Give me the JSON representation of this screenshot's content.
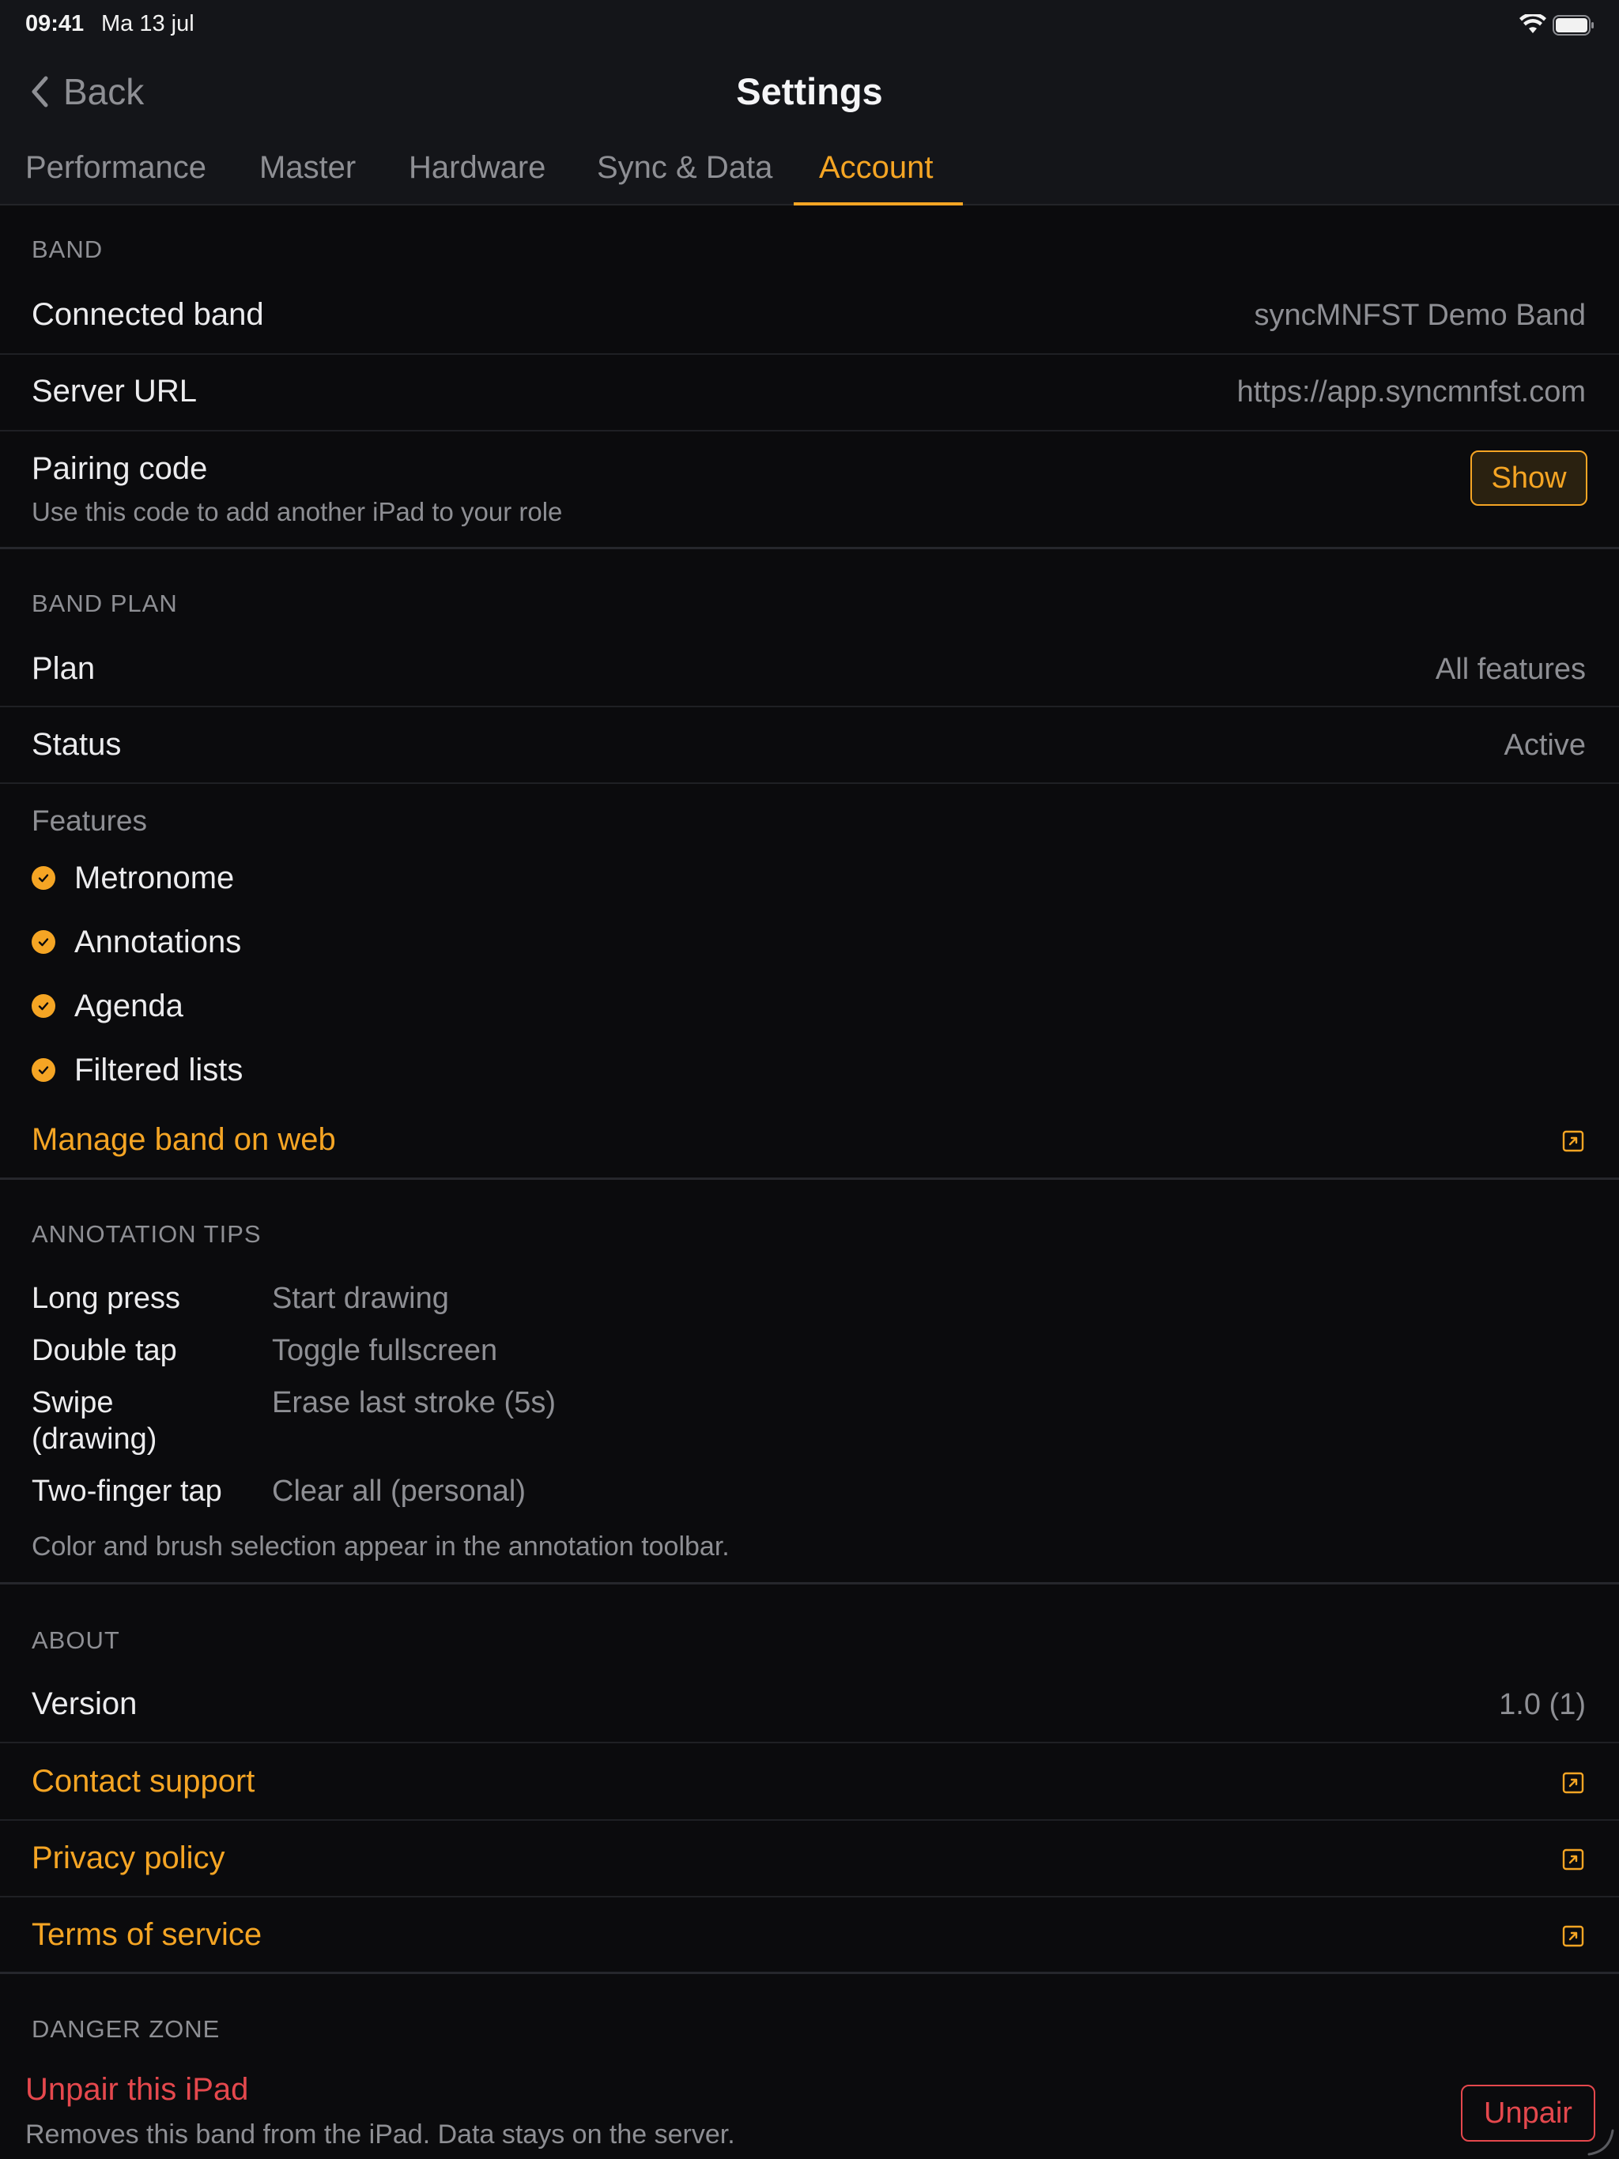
{
  "status_bar": {
    "time": "09:41",
    "date": "Ma 13 jul"
  },
  "nav": {
    "back_label": "Back",
    "title": "Settings"
  },
  "tabs": [
    {
      "label": "Performance",
      "active": false
    },
    {
      "label": "Master",
      "active": false
    },
    {
      "label": "Hardware",
      "active": false
    },
    {
      "label": "Sync & Data",
      "active": false
    },
    {
      "label": "Account",
      "active": true
    }
  ],
  "band": {
    "header": "BAND",
    "connected_band_label": "Connected band",
    "connected_band_value": "syncMNFST Demo Band",
    "server_url_label": "Server URL",
    "server_url_value": "https://app.syncmnfst.com",
    "pairing_code_label": "Pairing code",
    "pairing_code_sub": "Use this code to add another iPad to your role",
    "show_button": "Show"
  },
  "band_plan": {
    "header": "BAND PLAN",
    "plan_label": "Plan",
    "plan_value": "All features",
    "status_label": "Status",
    "status_value": "Active",
    "features_label": "Features",
    "features": [
      "Metronome",
      "Annotations",
      "Agenda",
      "Filtered lists"
    ],
    "manage_link": "Manage band on web"
  },
  "annotation_tips": {
    "header": "ANNOTATION TIPS",
    "tips": [
      {
        "gesture": "Long press",
        "action": "Start drawing"
      },
      {
        "gesture": "Double tap",
        "action": "Toggle fullscreen"
      },
      {
        "gesture": "Swipe (drawing)",
        "action": "Erase last stroke (5s)"
      },
      {
        "gesture": "Two-finger tap",
        "action": "Clear all (personal)"
      }
    ],
    "note": "Color and brush selection appear in the annotation toolbar."
  },
  "about": {
    "header": "ABOUT",
    "version_label": "Version",
    "version_value": "1.0 (1)",
    "links": [
      "Contact support",
      "Privacy policy",
      "Terms of service"
    ]
  },
  "danger_zone": {
    "header": "DANGER ZONE",
    "title": "Unpair this iPad",
    "sub": "Removes this band from the iPad. Data stays on the server.",
    "button": "Unpair"
  },
  "colors": {
    "accent": "#f5a524",
    "danger": "#e5484d",
    "background": "#0b0b0d",
    "bar": "#141519"
  },
  "icons": [
    "chevron-left-icon",
    "wifi-icon",
    "battery-icon",
    "checkmark-icon",
    "external-link-icon",
    "resize-handle-icon"
  ]
}
